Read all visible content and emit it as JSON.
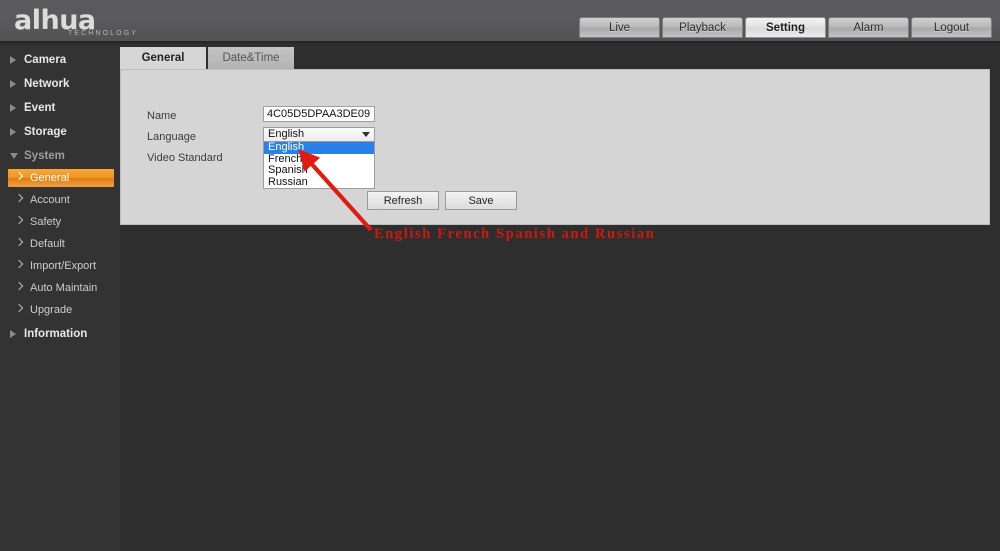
{
  "brand": {
    "logo_text": "alhua",
    "logo_sub": "TECHNOLOGY"
  },
  "header": {
    "nav": [
      {
        "label": "Live",
        "active": false
      },
      {
        "label": "Playback",
        "active": false
      },
      {
        "label": "Setting",
        "active": true
      },
      {
        "label": "Alarm",
        "active": false
      },
      {
        "label": "Logout",
        "active": false
      }
    ],
    "help_icon": "?"
  },
  "sidebar": {
    "items": [
      {
        "label": "Camera",
        "level": "top",
        "state": "collapsed"
      },
      {
        "label": "Network",
        "level": "top",
        "state": "collapsed"
      },
      {
        "label": "Event",
        "level": "top",
        "state": "collapsed"
      },
      {
        "label": "Storage",
        "level": "top",
        "state": "collapsed"
      },
      {
        "label": "System",
        "level": "top",
        "state": "expanded"
      },
      {
        "label": "General",
        "level": "sub",
        "state": "active"
      },
      {
        "label": "Account",
        "level": "sub",
        "state": "normal"
      },
      {
        "label": "Safety",
        "level": "sub",
        "state": "normal"
      },
      {
        "label": "Default",
        "level": "sub",
        "state": "normal"
      },
      {
        "label": "Import/Export",
        "level": "sub",
        "state": "normal"
      },
      {
        "label": "Auto Maintain",
        "level": "sub",
        "state": "normal"
      },
      {
        "label": "Upgrade",
        "level": "sub",
        "state": "normal"
      },
      {
        "label": "Information",
        "level": "top",
        "state": "collapsed"
      }
    ]
  },
  "main": {
    "tabs": [
      {
        "label": "General",
        "active": true
      },
      {
        "label": "Date&Time",
        "active": false
      }
    ],
    "form": {
      "name_label": "Name",
      "name_value": "4C05D5DPAA3DE09",
      "language_label": "Language",
      "language_value": "English",
      "language_options": [
        "English",
        "French",
        "Spanish",
        "Russian"
      ],
      "language_selected_index": 0,
      "video_standard_label": "Video Standard"
    },
    "buttons": [
      {
        "label": "Refresh"
      },
      {
        "label": "Save"
      }
    ]
  },
  "annotation": {
    "text": "English French Spanish and Russian",
    "color": "#cc1a10"
  },
  "colors": {
    "accent_orange": "#f0931f",
    "select_blue": "#2a7fe8",
    "panel_bg": "#d5d5d5",
    "sidebar_bg": "#333333",
    "page_bg": "#2e2e2e",
    "header_bg": "#59595b"
  }
}
